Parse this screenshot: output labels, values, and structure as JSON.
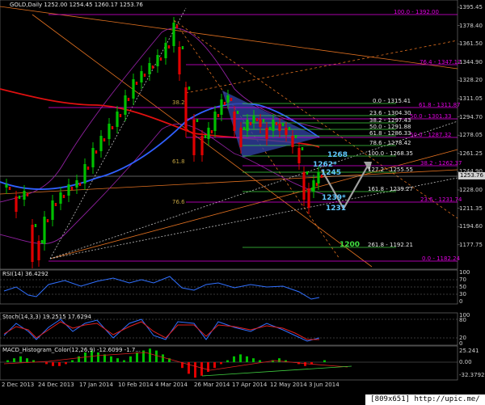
{
  "chart_header": {
    "title": "GOLD,Daily",
    "ohlc": "1252.00 1254.45 1260.17 1253.76"
  },
  "colors": {
    "background": "#000000",
    "bull_candle": "#00c000",
    "bear_candle": "#e00000",
    "fib_magenta": "#e000e0",
    "fib_green": "#40d040",
    "label_cyan": "#60c8ff",
    "label_white": "#e8e8e8",
    "label_green": "#40e040",
    "ma_red": "#e01010",
    "ma_blue": "#3060ff",
    "envelope_purple": "#9020a0",
    "pattern_fill": "#3040a0",
    "forecast_arrow": "#a0a0a0"
  },
  "price_axis": {
    "ticks": [
      "1395.45",
      "1378.40",
      "1361.50",
      "1344.90",
      "1328.20",
      "1311.05",
      "1294.70",
      "1278.05",
      "1261.25",
      "1244.90",
      "1228.00",
      "1211.35",
      "1194.60",
      "1177.75"
    ],
    "current_price": "1253.76"
  },
  "date_axis": {
    "ticks": [
      "2 Dec 2013",
      "24 Dec 2013",
      "17 Jan 2014",
      "10 Feb 2014",
      "4 Mar 2014",
      "26 Mar 2014",
      "17 Apr 2014",
      "12 May 2014",
      "3 Jun 2014"
    ]
  },
  "fib_levels_magenta": [
    {
      "label": "100.0 - 1392.00"
    },
    {
      "label": "76.4 - 1347.12"
    },
    {
      "label": "61.8 - 1311.87"
    },
    {
      "label": "50.0 - 1301.33"
    },
    {
      "label": "50.0 - 1287.32"
    },
    {
      "label": "38.2 - 1262.37"
    },
    {
      "label": "23.6 - 1231.74"
    },
    {
      "label": "0.0 - 1182.24"
    }
  ],
  "fib_levels_green": [
    {
      "label": "0.0 - 1315.41"
    },
    {
      "label": "23.6 - 1304.30"
    },
    {
      "label": "38.2 - 1297.43"
    },
    {
      "label": "50.0 - 1291.88"
    },
    {
      "label": "61.8 - 1286.33"
    },
    {
      "label": "78.6 - 1278.42"
    },
    {
      "label": "100.0 - 1268.35"
    },
    {
      "label": "127.2 - 1255.55"
    },
    {
      "label": "161.8 - 1239.27"
    },
    {
      "label": "261.8 - 1192.21"
    }
  ],
  "fib_inner_labels": {
    "a": "38.2",
    "b": "61.8",
    "c": "76.6"
  },
  "key_levels": {
    "l1268": "1268",
    "l1262": "1262*",
    "l1245": "1245",
    "l1239": "1239*",
    "l1231": "1231",
    "l1200": "1200"
  },
  "rsi": {
    "header": "RSI(14) 36.4292",
    "scale": [
      "100",
      "70",
      "50",
      "30",
      "0"
    ]
  },
  "stoch": {
    "header": "Stoch(14,3,3) 19.2515 17.6294",
    "scale": [
      "100",
      "80",
      "20",
      "0"
    ]
  },
  "macd": {
    "header": "MACD_Histogram_Color(12,26,9) -12.6099 -1.7...",
    "scale": [
      "25.241",
      "0.00",
      "-32.3792"
    ]
  },
  "watermark": "[809x651] http://upic.me/"
}
